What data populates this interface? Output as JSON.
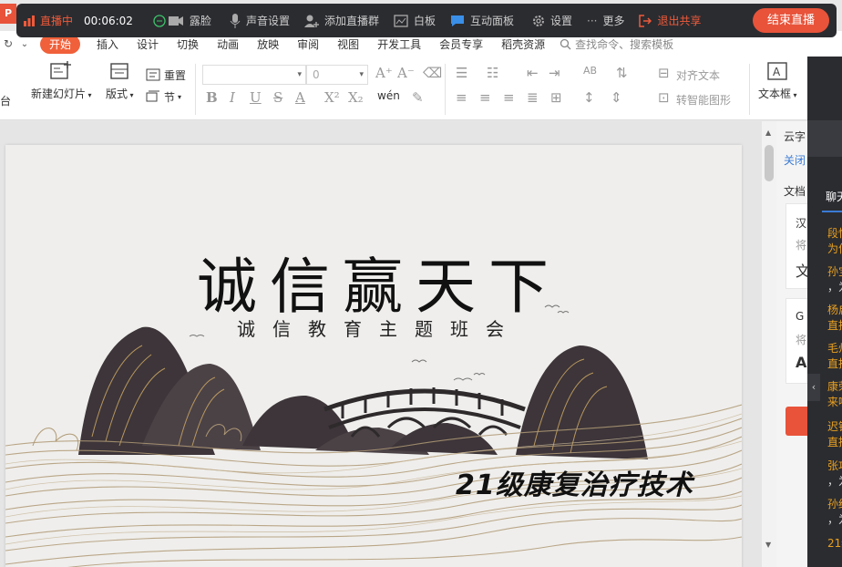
{
  "app": {
    "logo_label": "P"
  },
  "livebar": {
    "status": "直播中",
    "timer": "00:06:02",
    "items": [
      {
        "label": "露脸",
        "icon": "camera-icon"
      },
      {
        "label": "声音设置",
        "icon": "microphone-icon"
      },
      {
        "label": "添加直播群",
        "icon": "add-group-icon"
      },
      {
        "label": "白板",
        "icon": "whiteboard-icon"
      },
      {
        "label": "互动面板",
        "icon": "chat-bubble-icon"
      },
      {
        "label": "设置",
        "icon": "gear-icon"
      },
      {
        "label": "更多",
        "icon": "more-icon"
      }
    ],
    "exit_label": "退出共享",
    "end_label": "结束直播"
  },
  "menubar": {
    "tabs": [
      "开始",
      "插入",
      "设计",
      "切换",
      "动画",
      "放映",
      "审阅",
      "视图",
      "开发工具",
      "会员专享",
      "稻壳资源"
    ],
    "active_tab": "开始",
    "search_placeholder": "查找命令、搜索模板"
  },
  "ribbon": {
    "left_partial": "台",
    "new_slide": "新建幻灯片",
    "layout": "版式",
    "reset": "重置",
    "section": "节",
    "font_name": "",
    "font_size": "0",
    "align_text": "对齐文本",
    "smartart": "转智能图形",
    "textbox": "文本框",
    "phonetic": "wén"
  },
  "slide": {
    "title": "诚信赢天下",
    "subtitle": "诚信教育主题班会",
    "class_name": "21级康复治疗技术"
  },
  "rpanel": {
    "line1": "云字",
    "line2": "关闭",
    "line3": "文档",
    "c1a": "汉",
    "c1b": "将",
    "c1c": "文",
    "c2a": "G",
    "c2b": "将",
    "c2c": "A"
  },
  "chat": {
    "tab": "聊天",
    "messages": [
      {
        "text": "段怡",
        "color": "orange"
      },
      {
        "text": "为何",
        "color": "orange"
      },
      {
        "text": "孙宝",
        "color": "orange"
      },
      {
        "text": "，为",
        "color": "white"
      },
      {
        "text": "杨启",
        "color": "orange"
      },
      {
        "text": "直播",
        "color": "orange"
      },
      {
        "text": "毛州",
        "color": "orange"
      },
      {
        "text": "直播",
        "color": "orange"
      },
      {
        "text": "康荣",
        "color": "orange"
      },
      {
        "text": "来啦",
        "color": "orange"
      },
      {
        "text": "迟铭",
        "color": "orange"
      },
      {
        "text": "直播",
        "color": "orange"
      },
      {
        "text": "张巧",
        "color": "orange"
      },
      {
        "text": "，为",
        "color": "white"
      },
      {
        "text": "孙红",
        "color": "orange"
      },
      {
        "text": "，为",
        "color": "white"
      },
      {
        "text": "21级",
        "color": "orange"
      }
    ]
  },
  "colors": {
    "accent": "#f0603a",
    "live_bg": "#2b2c30",
    "end_button": "#e8533a",
    "chat_text": "#e8a020"
  }
}
